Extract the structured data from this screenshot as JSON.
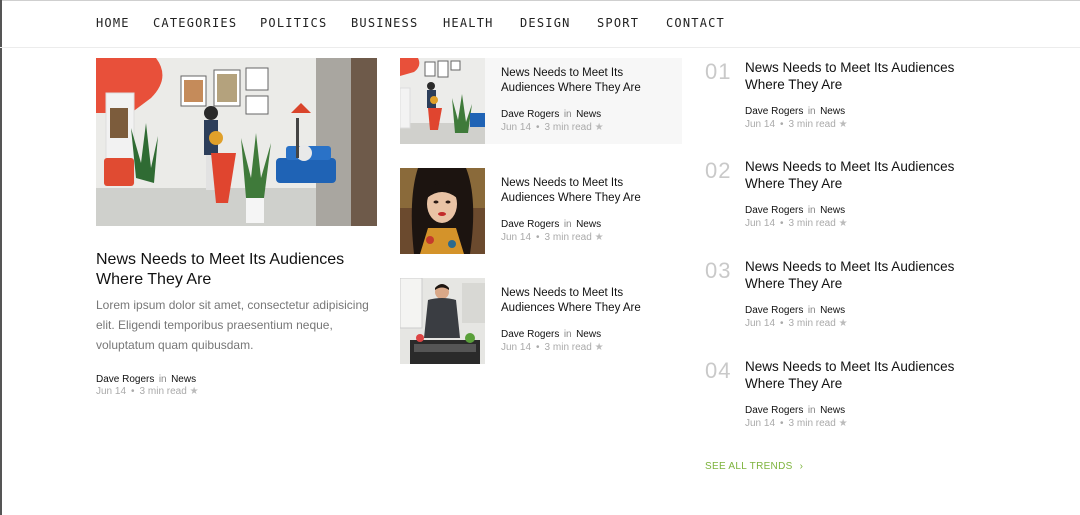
{
  "nav": {
    "items": [
      "HOME",
      "CATEGORIES",
      "POLITICS",
      "BUSINESS",
      "HEALTH",
      "DESIGN",
      "SPORT",
      "CONTACT"
    ]
  },
  "featured": {
    "title": "News Needs to Meet Its Audiences Where They Are",
    "excerpt": "Lorem ipsum dolor sit amet, consectetur adipisicing elit. Eligendi temporibus praesentium neque, voluptatum quam quibusdam.",
    "author": "Dave Rogers",
    "in_label": "in",
    "category": "News",
    "date": "Jun 14",
    "read_time": "3 min read"
  },
  "middle": [
    {
      "title": "News Needs to Meet Its Audiences Where They Are",
      "author": "Dave Rogers",
      "in_label": "in",
      "category": "News",
      "date": "Jun 14",
      "read_time": "3 min read"
    },
    {
      "title": "News Needs to Meet Its Audiences Where They Are",
      "author": "Dave Rogers",
      "in_label": "in",
      "category": "News",
      "date": "Jun 14",
      "read_time": "3 min read"
    },
    {
      "title": "News Needs to Meet Its Audiences Where They Are",
      "author": "Dave Rogers",
      "in_label": "in",
      "category": "News",
      "date": "Jun 14",
      "read_time": "3 min read"
    }
  ],
  "trends": [
    {
      "number": "01",
      "title": "News Needs to Meet Its Audiences Where They Are",
      "author": "Dave Rogers",
      "in_label": "in",
      "category": "News",
      "date": "Jun 14",
      "read_time": "3 min read"
    },
    {
      "number": "02",
      "title": "News Needs to Meet Its Audiences Where They Are",
      "author": "Dave Rogers",
      "in_label": "in",
      "category": "News",
      "date": "Jun 14",
      "read_time": "3 min read"
    },
    {
      "number": "03",
      "title": "News Needs to Meet Its Audiences Where They Are",
      "author": "Dave Rogers",
      "in_label": "in",
      "category": "News",
      "date": "Jun 14",
      "read_time": "3 min read"
    },
    {
      "number": "04",
      "title": "News Needs to Meet Its Audiences Where They Are",
      "author": "Dave Rogers",
      "in_label": "in",
      "category": "News",
      "date": "Jun 14",
      "read_time": "3 min read"
    }
  ],
  "see_all": {
    "label": "SEE ALL TRENDS",
    "arrow": "›"
  },
  "icons": {
    "star": "star-icon",
    "chevron": "chevron-right-icon"
  },
  "colors": {
    "accent": "#7db33c",
    "text": "#111111",
    "muted": "#aaaaaa"
  }
}
